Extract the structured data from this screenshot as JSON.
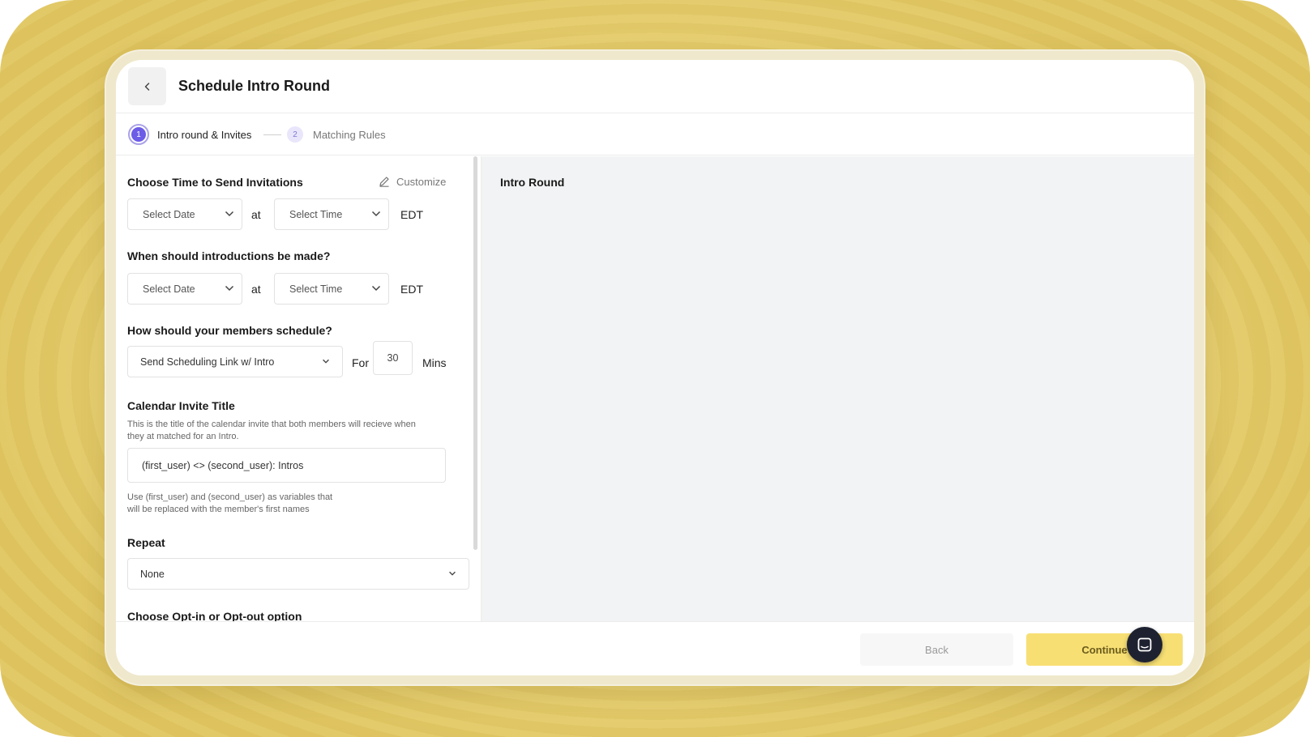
{
  "header": {
    "title": "Schedule Intro Round",
    "back_icon": "chevron-left-icon"
  },
  "stepper": {
    "steps": [
      {
        "number": "1",
        "label": "Intro round & Invites",
        "active": true
      },
      {
        "number": "2",
        "label": "Matching Rules",
        "active": false
      }
    ]
  },
  "invitations": {
    "title": "Choose Time to Send Invitations",
    "customize_label": "Customize",
    "date_placeholder": "Select Date",
    "at_label": "at",
    "time_placeholder": "Select Time",
    "timezone": "EDT"
  },
  "introductions": {
    "title": "When should introductions be made?",
    "date_placeholder": "Select Date",
    "at_label": "at",
    "time_placeholder": "Select Time",
    "timezone": "EDT"
  },
  "schedule": {
    "title": "How should your members schedule?",
    "method_value": "Send Scheduling Link w/ Intro",
    "for_label": "For",
    "duration_value": "30",
    "unit_label": "Mins"
  },
  "calendar": {
    "title": "Calendar Invite Title",
    "description_line1": "This is the title of the calendar invite that both members will recieve when",
    "description_line2": "they at matched for an Intro.",
    "input_value": "(first_user) <> (second_user): Intros",
    "hint_line1": "Use (first_user) and (second_user) as variables that",
    "hint_line2": "will be replaced with the member's first names"
  },
  "repeat": {
    "title": "Repeat",
    "value": "None"
  },
  "opt": {
    "title": "Choose Opt-in or Opt-out option"
  },
  "preview": {
    "title": "Intro Round"
  },
  "footer": {
    "back_label": "Back",
    "continue_label": "Continue"
  },
  "colors": {
    "accent": "#6c5ce7",
    "continue": "#f7df74",
    "background": "#e6cd6c"
  }
}
